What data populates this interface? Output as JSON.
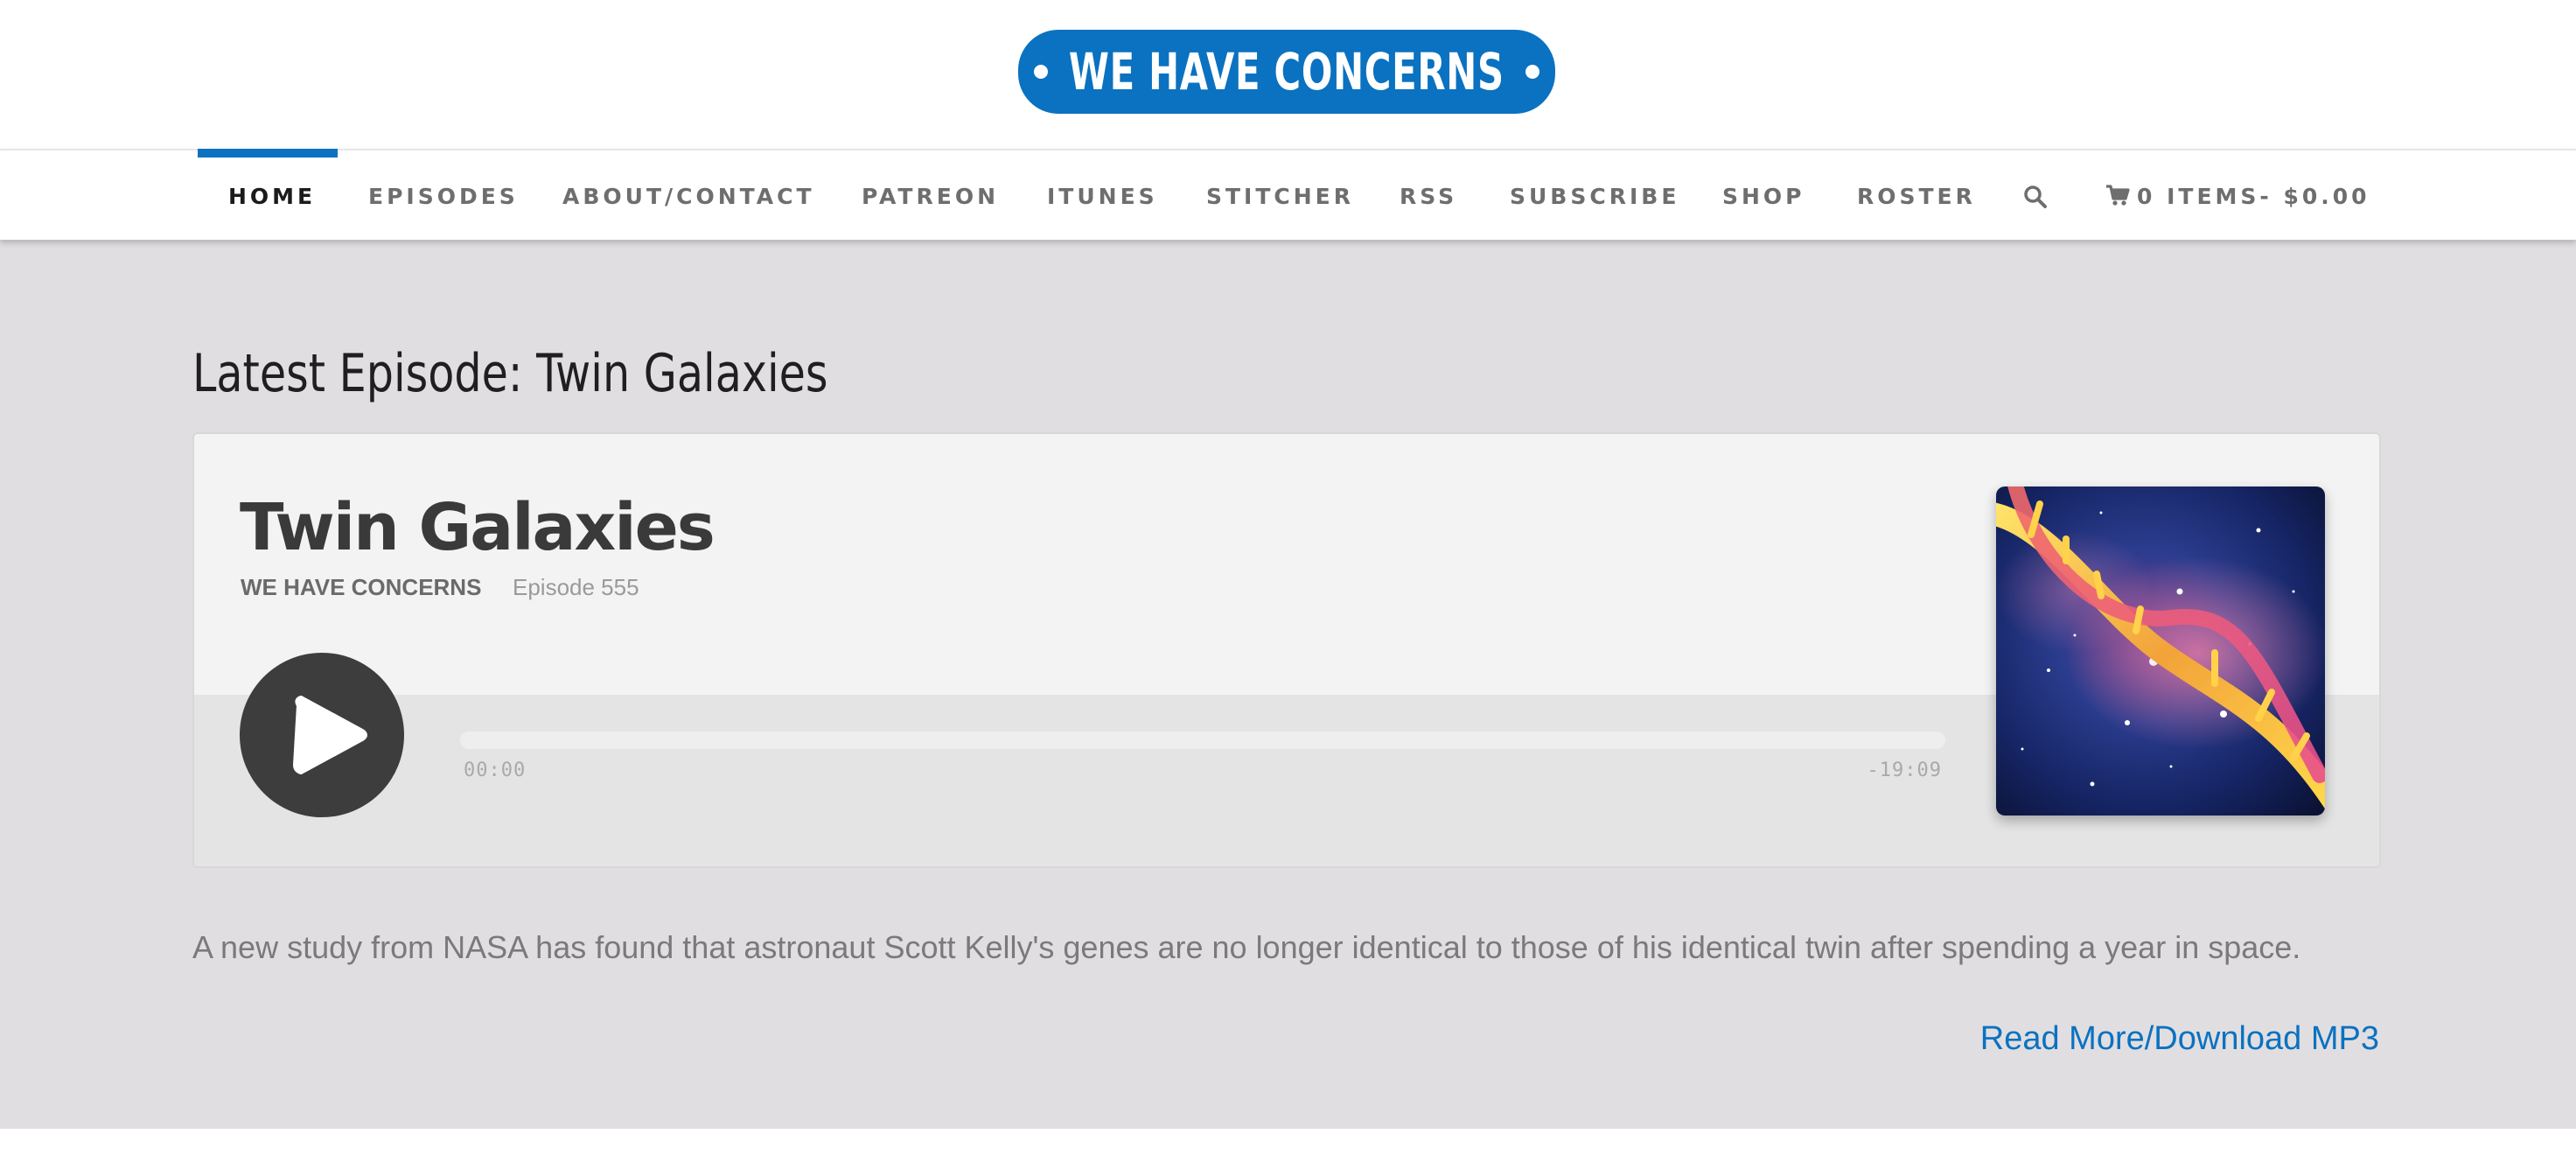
{
  "logo": {
    "text": "WE HAVE CONCERNS",
    "color": "#0a72c0"
  },
  "nav": {
    "items": [
      {
        "label": "HOME",
        "active": true
      },
      {
        "label": "EPISODES"
      },
      {
        "label": "ABOUT/CONTACT"
      },
      {
        "label": "PATREON"
      },
      {
        "label": "ITUNES"
      },
      {
        "label": "STITCHER"
      },
      {
        "label": "RSS"
      },
      {
        "label": "SUBSCRIBE"
      },
      {
        "label": "SHOP"
      },
      {
        "label": "ROSTER"
      }
    ],
    "search_icon": "search-icon",
    "cart_icon": "cart-icon",
    "cart_label": "0 ITEMS- $0.00"
  },
  "latest": {
    "heading": "Latest Episode: Twin Galaxies"
  },
  "player": {
    "title": "Twin Galaxies",
    "show": "WE HAVE CONCERNS",
    "episode": "Episode 555",
    "elapsed": "00:00",
    "remaining": "-19:09",
    "progress": 0,
    "play_icon": "play-icon",
    "artwork": "dna-galaxy-artwork"
  },
  "description": "A new study from NASA has found that astronaut Scott Kelly's genes are no longer identical to those of his identical twin after spending a year in space.",
  "read_more": "Read More/Download MP3",
  "colors": {
    "accent": "#0a72c0",
    "background": "#e1dee1",
    "player_dark": "#3d3d3d"
  }
}
